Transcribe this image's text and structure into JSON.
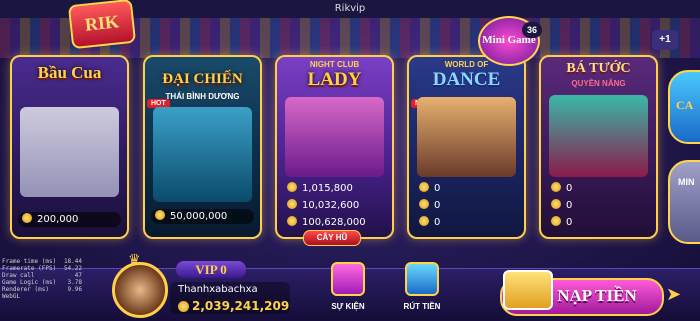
{
  "window": {
    "title": "Rikvip"
  },
  "logo": "RIK",
  "tiles": [
    {
      "title": "Bầu Cua",
      "amounts": [
        "200,000"
      ]
    },
    {
      "title": "ĐẠI CHIẾN",
      "subtitle": "THÁI BÌNH DƯƠNG",
      "badge": "HOT",
      "amounts": [
        "50,000,000"
      ]
    },
    {
      "title": "LADY",
      "pre": "NIGHT CLUB",
      "jackpots": [
        "1,015,800",
        "10,032,600",
        "100,628,000"
      ],
      "button": "CÂY HŨ"
    },
    {
      "title": "DANCE",
      "pre": "WORLD OF",
      "badge": "NEW",
      "jackpots": [
        "0",
        "0",
        "0"
      ]
    },
    {
      "title": "BÁ TƯỚC",
      "subtitle": "QUYỀN NĂNG",
      "jackpots": [
        "0",
        "0",
        "0"
      ]
    }
  ],
  "minigame": {
    "label": "Mini Game",
    "count": "36"
  },
  "plus_button": "+1",
  "edge_items": [
    "CA",
    "MIN"
  ],
  "debug_stats": [
    {
      "label": "Frame time (ms)",
      "value": "18.44"
    },
    {
      "label": "Framerate (FPS)",
      "value": "54.22"
    },
    {
      "label": "Draw call",
      "value": "47"
    },
    {
      "label": "Game Logic (ms)",
      "value": "3.78"
    },
    {
      "label": "Renderer (ms)",
      "value": "9.96"
    },
    {
      "label": "WebGL",
      "value": ""
    }
  ],
  "user": {
    "vip": "VIP 0",
    "name": "Thanhxabachxa",
    "balance": "2,039,241,209"
  },
  "nav": {
    "event_label": "SỰ KIỆN",
    "withdraw_label": "RÚT TIỀN",
    "deposit_label": "NẠP TIỀN"
  }
}
